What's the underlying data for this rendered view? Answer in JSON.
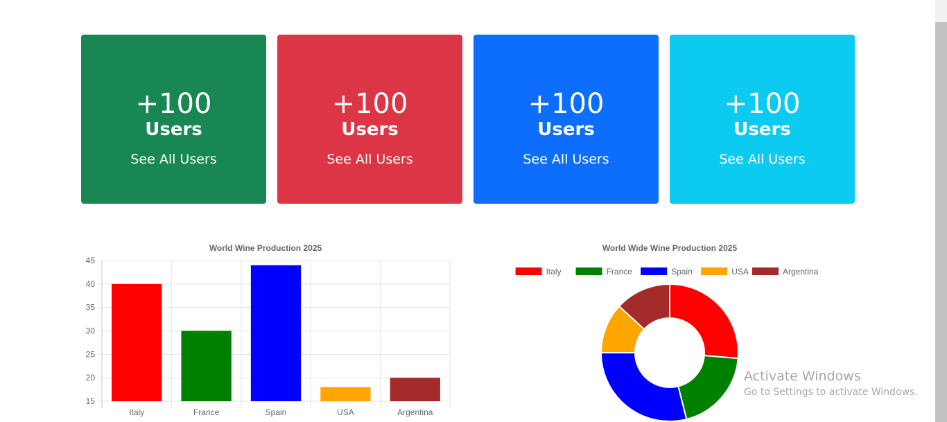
{
  "cards": [
    {
      "number": "+100",
      "title": "Users",
      "link": "See All Users",
      "color": "#198754"
    },
    {
      "number": "+100",
      "title": "Users",
      "link": "See All Users",
      "color": "#dc3545"
    },
    {
      "number": "+100",
      "title": "Users",
      "link": "See All Users",
      "color": "#0d6efd"
    },
    {
      "number": "+100",
      "title": "Users",
      "link": "See All Users",
      "color": "#0dcaf0"
    }
  ],
  "watermark": {
    "line1": "Activate Windows",
    "line2": "Go to Settings to activate Windows."
  },
  "chart_data": [
    {
      "type": "bar",
      "title": "World Wine Production 2025",
      "categories": [
        "Italy",
        "France",
        "Spain",
        "USA",
        "Argentina"
      ],
      "values": [
        40,
        30,
        44,
        18,
        20
      ],
      "colors": [
        "#ff0000",
        "#008000",
        "#0000ff",
        "#ffa500",
        "#a52a2a"
      ],
      "ylim": [
        15,
        45
      ],
      "yticks": [
        15,
        20,
        25,
        30,
        35,
        40,
        45
      ],
      "legend": "none",
      "grid": true
    },
    {
      "type": "pie",
      "title": "World Wide Wine Production 2025",
      "categories": [
        "Italy",
        "France",
        "Spain",
        "USA",
        "Argentina"
      ],
      "values": [
        40,
        30,
        44,
        18,
        20
      ],
      "colors": [
        "#ff0000",
        "#008000",
        "#0000ff",
        "#ffa500",
        "#a52a2a"
      ],
      "legend": "top",
      "donut": true
    }
  ]
}
